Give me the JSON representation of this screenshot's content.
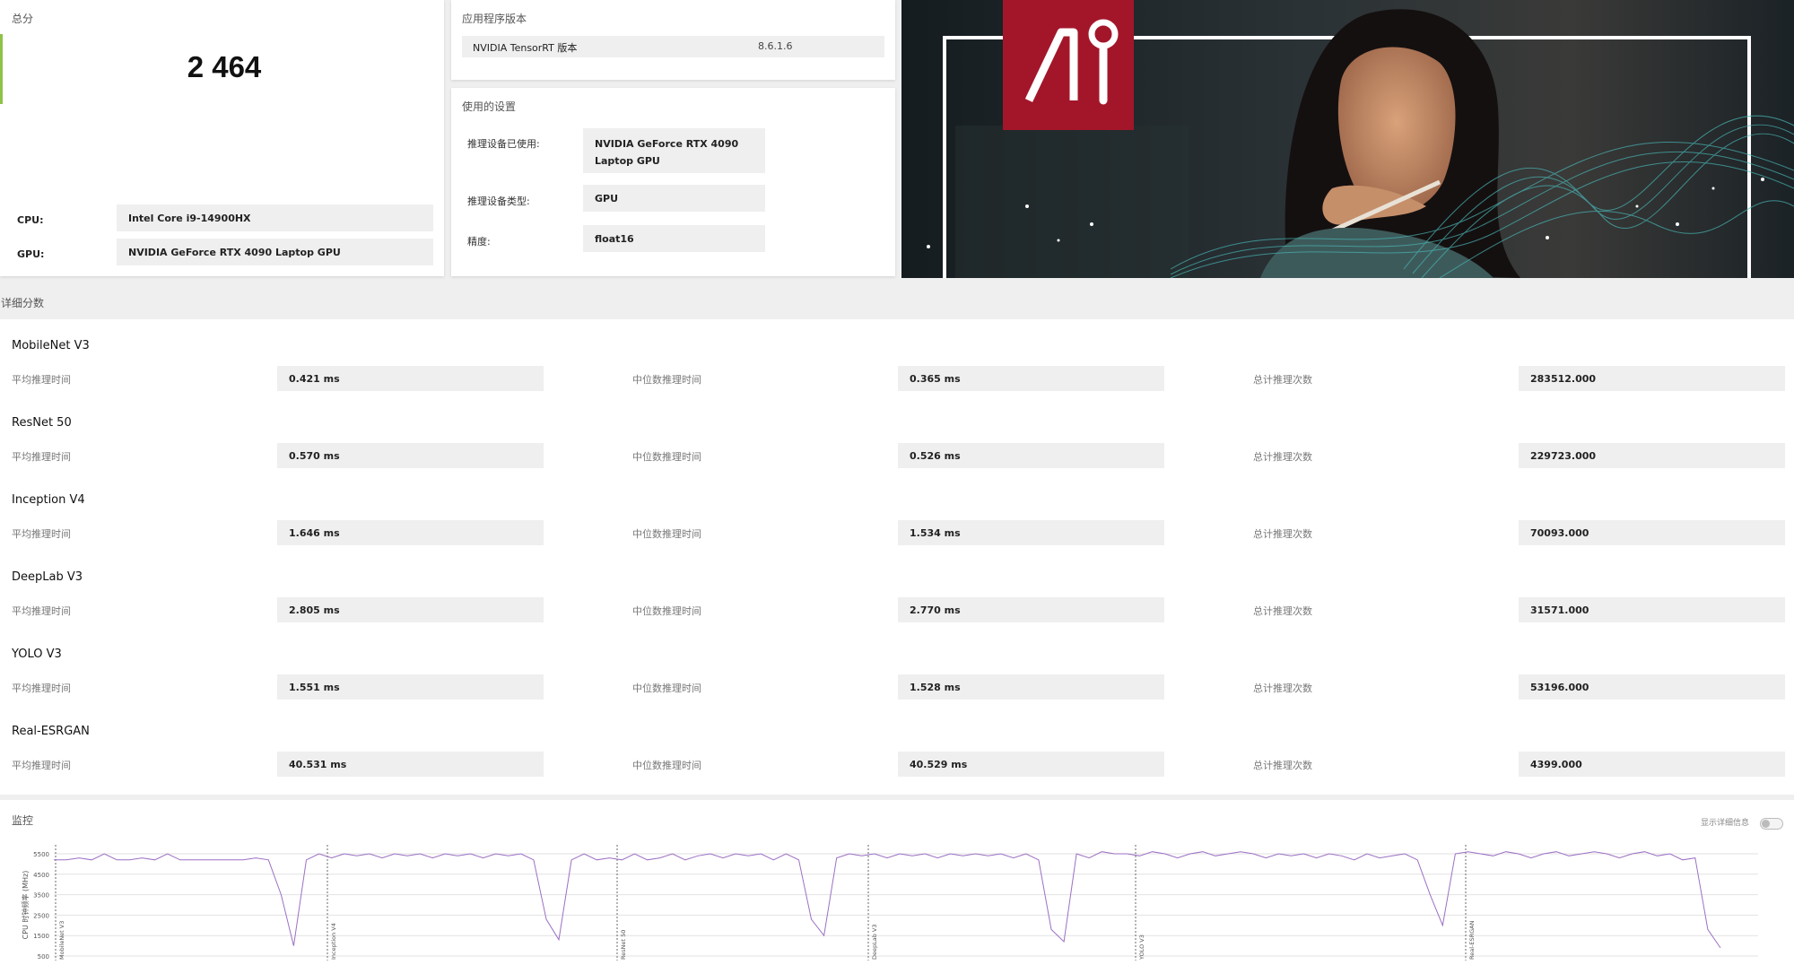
{
  "summary": {
    "caption": "总分",
    "score": "2 464",
    "cpu_label": "CPU:",
    "cpu_value": "Intel Core i9-14900HX",
    "gpu_label": "GPU:",
    "gpu_value": "NVIDIA GeForce RTX 4090 Laptop GPU",
    "accent_color": "#8fc24a"
  },
  "version": {
    "caption": "应用程序版本",
    "name": "NVIDIA TensorRT 版本",
    "value": "8.6.1.6"
  },
  "settings": {
    "caption": "使用的设置",
    "rows": [
      {
        "label": "推理设备已使用:",
        "value_line1": "NVIDIA GeForce RTX 4090",
        "value_line2": "Laptop GPU"
      },
      {
        "label": "推理设备类型:",
        "value_line1": "GPU",
        "value_line2": ""
      },
      {
        "label": "精度:",
        "value_line1": "float16",
        "value_line2": ""
      }
    ]
  },
  "hero": {
    "logo_icon": "ai-logo-icon",
    "logo_color": "#a3162a"
  },
  "detail": {
    "caption": "详细分数",
    "metric_avg": "平均推理时间",
    "metric_median": "中位数推理时间",
    "metric_total": "总计推理次数",
    "benchmarks": [
      {
        "name": "MobileNet V3",
        "avg": "0.421 ms",
        "median": "0.365 ms",
        "total": "283512.000"
      },
      {
        "name": "ResNet 50",
        "avg": "0.570 ms",
        "median": "0.526 ms",
        "total": "229723.000"
      },
      {
        "name": "Inception V4",
        "avg": "1.646 ms",
        "median": "1.534 ms",
        "total": "70093.000"
      },
      {
        "name": "DeepLab V3",
        "avg": "2.805 ms",
        "median": "2.770 ms",
        "total": "31571.000"
      },
      {
        "name": "YOLO V3",
        "avg": "1.551 ms",
        "median": "1.528 ms",
        "total": "53196.000"
      },
      {
        "name": "Real-ESRGAN",
        "avg": "40.531 ms",
        "median": "40.529 ms",
        "total": "4399.000"
      }
    ]
  },
  "monitor": {
    "caption": "监控",
    "toggle_label": "显示详细信息",
    "toggle_on": false,
    "line_color": "#9b6fc4"
  },
  "chart_data": {
    "type": "line",
    "ylabel": "CPU 时钟频率 (MHz)",
    "y_ticks": [
      "5500",
      "4500",
      "3500",
      "2500",
      "1500",
      "500"
    ],
    "ylim": [
      500,
      5500
    ],
    "grid": true,
    "segments": [
      "MobileNet V3",
      "Inception V4",
      "ResNet 50",
      "DeepLab V3",
      "YOLO V3",
      "Real-ESRGAN"
    ],
    "series": [
      {
        "values": [
          5200,
          5200,
          5300,
          5200,
          5500,
          5200,
          5200,
          5300,
          5200,
          5500,
          5200,
          5200,
          5200,
          5200,
          5200,
          5200,
          5300,
          5200,
          3500,
          1000,
          5200,
          5500,
          5300,
          5500,
          5400,
          5500,
          5300,
          5500,
          5400,
          5500,
          5300,
          5500,
          5400,
          5500,
          5300,
          5500,
          5400,
          5500,
          5200,
          2300,
          1300,
          5200,
          5500,
          5200,
          5300,
          5200,
          5500,
          5200,
          5300,
          5500,
          5200,
          5400,
          5500,
          5300,
          5500,
          5400,
          5500,
          5200,
          5500,
          5200,
          2300,
          1500,
          5300,
          5500,
          5400,
          5500,
          5300,
          5500,
          5400,
          5500,
          5300,
          5500,
          5400,
          5500,
          5400,
          5500,
          5300,
          5500,
          5200,
          1800,
          1200,
          5500,
          5300,
          5600,
          5500,
          5500,
          5400,
          5600,
          5500,
          5300,
          5500,
          5600,
          5400,
          5500,
          5600,
          5500,
          5300,
          5500,
          5400,
          5500,
          5300,
          5500,
          5400,
          5200,
          5500,
          5300,
          5400,
          5500,
          5200,
          3500,
          2000,
          5500,
          5600,
          5500,
          5400,
          5600,
          5500,
          5300,
          5500,
          5600,
          5400,
          5500,
          5600,
          5500,
          5300,
          5500,
          5600,
          5400,
          5500,
          5200,
          5300,
          1800,
          900
        ]
      }
    ]
  }
}
